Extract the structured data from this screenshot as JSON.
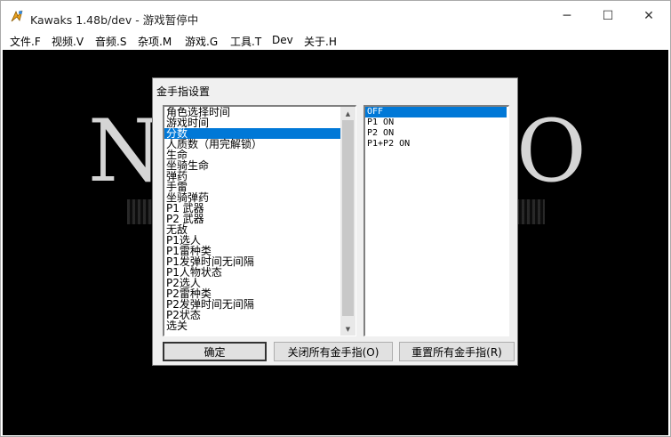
{
  "window": {
    "title": "Kawaks 1.48b/dev - 游戏暂停中",
    "controls": {
      "minimize": "─",
      "maximize": "☐",
      "close": "✕"
    }
  },
  "menubar": {
    "items": [
      "文件.F",
      "视频.V",
      "音频.S",
      "杂项.M",
      "游戏.G",
      "工具.T",
      "Dev",
      "关于.H"
    ]
  },
  "background": {
    "letters": [
      "N",
      "O"
    ]
  },
  "dialog": {
    "title": "金手指设置",
    "cheats": [
      "角色选择时间",
      "游戏时间",
      "分数",
      "人质数（用完解锁）",
      "生命",
      "坐骑生命",
      "弹药",
      "手雷",
      "坐骑弹药",
      "P1 武器",
      "P2 武器",
      "无敌",
      "P1选人",
      "P1雷种类",
      "P1发弹时间无间隔",
      "P1人物状态",
      "P2选人",
      "P2雷种类",
      "P2发弹时间无间隔",
      "P2状态",
      "选关"
    ],
    "selected_cheat_index": 2,
    "options": [
      "OFF",
      "P1 ON",
      "P2 ON",
      "P1+P2 ON"
    ],
    "selected_option_index": 0,
    "buttons": {
      "ok": "确定",
      "close_all": "关闭所有金手指(O)",
      "reset_all": "重置所有金手指(R)"
    }
  },
  "colors": {
    "selection": "#0078d7",
    "game_background": "#000000",
    "dialog_background": "#f0f0f0"
  }
}
